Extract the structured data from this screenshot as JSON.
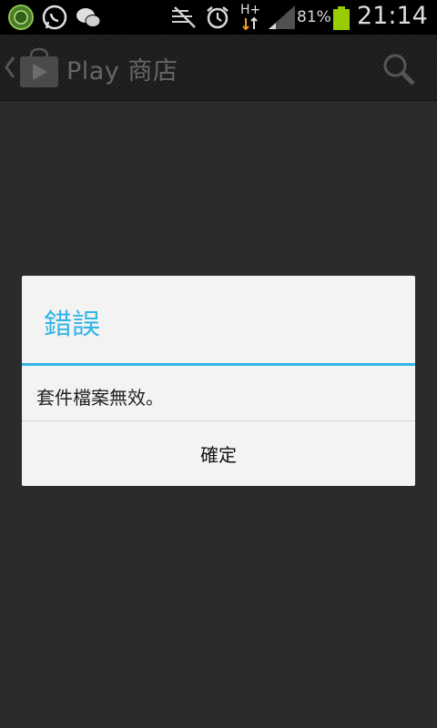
{
  "status_bar": {
    "battery_percent": "81%",
    "time": "21:14",
    "network_type": "H+",
    "icons": [
      "security-shield-icon",
      "whatsapp-icon",
      "wechat-icon",
      "no-signal-sync-icon",
      "alarm-clock-icon",
      "network-data-icon",
      "signal-strength-icon",
      "battery-icon"
    ]
  },
  "action_bar": {
    "title": "Play 商店",
    "icons": [
      "up-navigation-icon",
      "play-store-icon",
      "search-icon"
    ]
  },
  "dialog": {
    "title": "錯誤",
    "message": "套件檔案無效。",
    "button_label": "確定"
  },
  "colors": {
    "accent": "#33b5e5",
    "battery_fill": "#99cc00",
    "background": "#2b2b2b"
  }
}
